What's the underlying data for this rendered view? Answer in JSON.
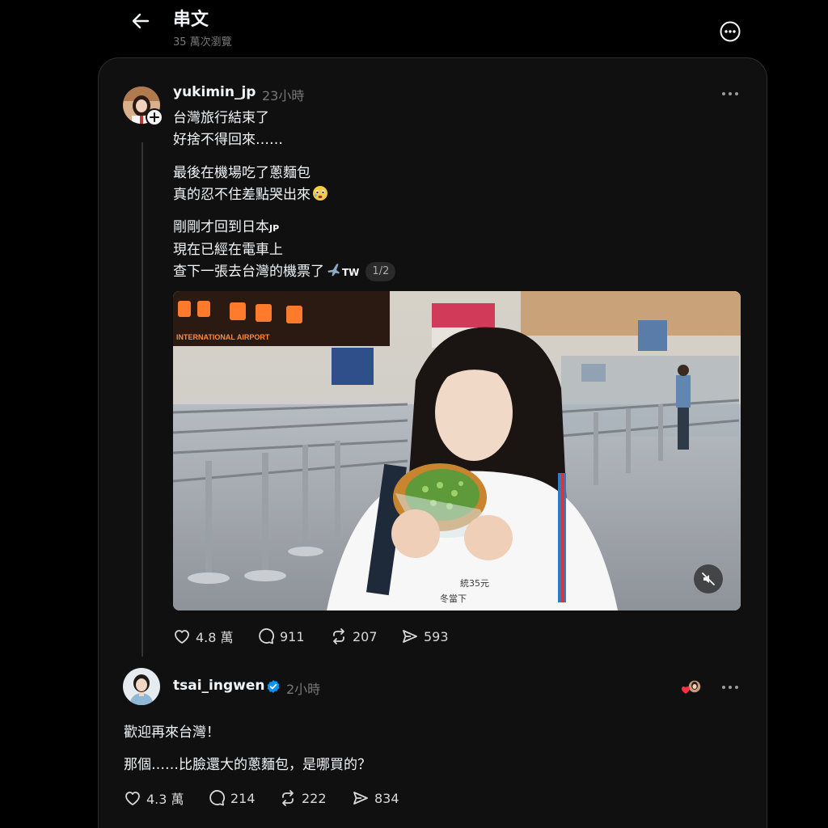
{
  "header": {
    "title": "串文",
    "views": "35 萬次瀏覽"
  },
  "post": {
    "author": "yukimin_jp",
    "time": "23小時",
    "paragraphs": [
      [
        "台灣旅行結束了",
        "好捨不得回來……"
      ],
      [
        "最後在機場吃了蔥麵包",
        "真的忍不住差點哭出來"
      ],
      [
        "剛剛才回到日本",
        "現在已經在電車上",
        "查下一張去台灣的機票了"
      ]
    ],
    "emoji_label_jp": "JP",
    "emoji_label_tw": "TW",
    "media_counter": "1/2",
    "media_signs": {
      "airport_sign": "INTERNATIONAL AIRPORT",
      "shirt_price": "統35元",
      "shirt_text": "冬當下"
    },
    "stats": {
      "likes": "4.8 萬",
      "comments": "911",
      "reposts": "207",
      "shares": "593"
    }
  },
  "reply": {
    "author": "tsai_ingwen",
    "time": "2小時",
    "lines": [
      "歡迎再來台灣！",
      "那個……比臉還大的蔥麵包，是哪買的？"
    ],
    "stats": {
      "likes": "4.3 萬",
      "comments": "214",
      "reposts": "222",
      "shares": "834"
    }
  },
  "colors": {
    "background": "#000000",
    "card": "#101010",
    "text": "#f3f5f7",
    "muted": "#777777",
    "verified": "#0095f6",
    "heart": "#ff3040"
  },
  "icons": [
    "back-arrow-icon",
    "more-circle-icon",
    "heart-icon",
    "comment-icon",
    "repost-icon",
    "share-icon",
    "mute-icon",
    "verified-badge-icon",
    "plus-icon",
    "crying-face-emoji",
    "airplane-emoji"
  ]
}
